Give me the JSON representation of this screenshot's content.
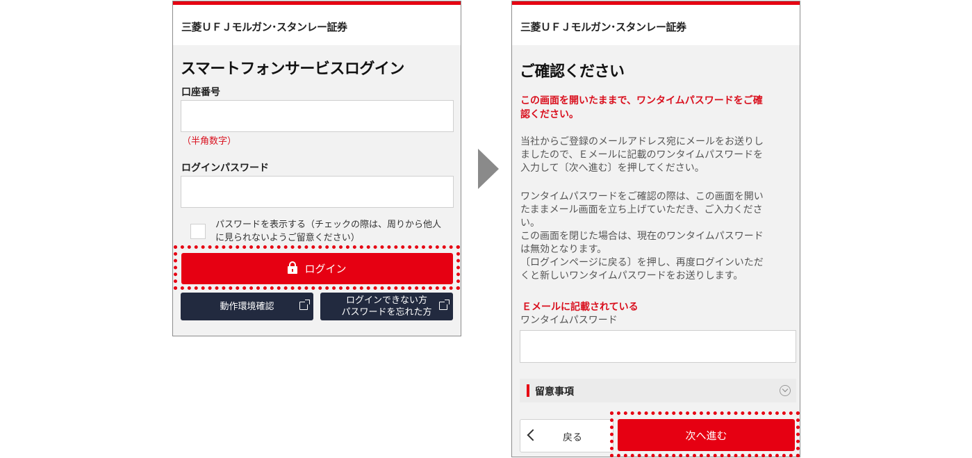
{
  "login": {
    "brand": "三菱ＵＦＪモルガン･スタンレー証券",
    "title": "スマートフォンサービスログイン",
    "account_label": "口座番号",
    "account_note": "（半角数字）",
    "password_label": "ログインパスワード",
    "show_password_line1": "パスワードを表示する（チェックの際は、周りから他人",
    "show_password_line2": "に見られないようご留意ください）",
    "login_button": "ログイン",
    "env_button": "動作環境確認",
    "help_line1": "ログインできない方",
    "help_line2": "パスワードを忘れた方"
  },
  "confirm": {
    "brand": "三菱ＵＦＪモルガン･スタンレー証券",
    "title": "ご確認ください",
    "warning_line1": "この画面を開いたままで、ワンタイムパスワードをご確",
    "warning_line2": "認ください。",
    "para1_line1": "当社からご登録のメールアドレス宛にメールをお送りし",
    "para1_line2": "ましたので、Ｅメールに記載のワンタイムパスワードを",
    "para1_line3": "入力して〔次へ進む〕を押してください。",
    "para2_line1": "ワンタイムパスワードをご確認の際は、この画面を開い",
    "para2_line2": "たままメール画面を立ち上げていただき、ご入力くださ",
    "para2_line3": "い。",
    "para2_line4": "この画面を閉じた場合は、現在のワンタイムパスワード",
    "para2_line5": "は無効となります。",
    "para2_line6": "〔ログインページに戻る〕を押し、再度ログインいただ",
    "para2_line7": "くと新しいワンタイムパスワードをお送りします。",
    "otp_label_red": "Ｅメールに記載されている",
    "otp_label": "ワンタイムパスワード",
    "notes_label": "留意事項",
    "back_button": "戻る",
    "next_button": "次へ進む"
  },
  "colors": {
    "accent": "#e60012",
    "dark_button": "#222a3f",
    "panel": "#f2f2f2"
  }
}
